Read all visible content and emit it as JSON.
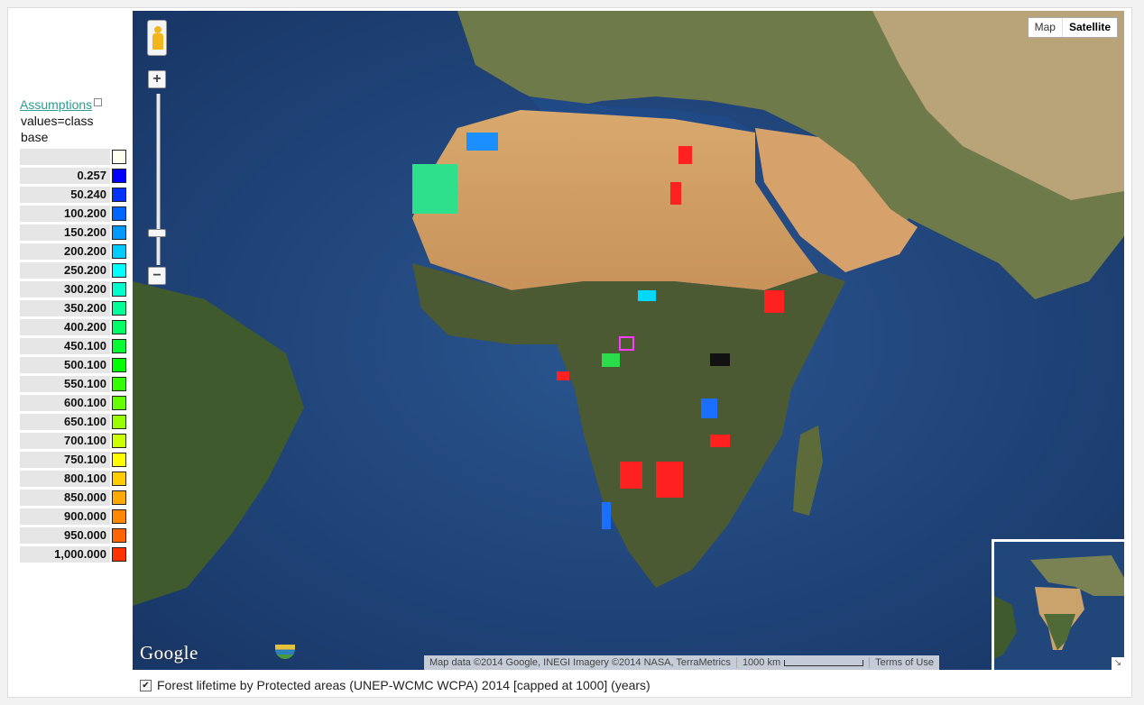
{
  "legend": {
    "link_label": "Assumptions",
    "meta_line1": "values=class",
    "meta_line2": "base",
    "items": [
      {
        "value": "",
        "color": "#fffff0"
      },
      {
        "value": "0.257",
        "color": "#0000ff"
      },
      {
        "value": "50.240",
        "color": "#0033ff"
      },
      {
        "value": "100.200",
        "color": "#0066ff"
      },
      {
        "value": "150.200",
        "color": "#0099ff"
      },
      {
        "value": "200.200",
        "color": "#00ccff"
      },
      {
        "value": "250.200",
        "color": "#00ffff"
      },
      {
        "value": "300.200",
        "color": "#00ffcc"
      },
      {
        "value": "350.200",
        "color": "#00ff99"
      },
      {
        "value": "400.200",
        "color": "#00ff66"
      },
      {
        "value": "450.100",
        "color": "#00ff33"
      },
      {
        "value": "500.100",
        "color": "#00ff00"
      },
      {
        "value": "550.100",
        "color": "#33ff00"
      },
      {
        "value": "600.100",
        "color": "#66ff00"
      },
      {
        "value": "650.100",
        "color": "#99ff00"
      },
      {
        "value": "700.100",
        "color": "#ccff00"
      },
      {
        "value": "750.100",
        "color": "#ffff00"
      },
      {
        "value": "800.100",
        "color": "#ffcc00"
      },
      {
        "value": "850.000",
        "color": "#ffaa00"
      },
      {
        "value": "900.000",
        "color": "#ff8800"
      },
      {
        "value": "950.000",
        "color": "#ff6600"
      },
      {
        "value": "1,000.000",
        "color": "#ff3300"
      }
    ]
  },
  "map": {
    "type_map_label": "Map",
    "type_satellite_label": "Satellite",
    "zoom_in_label": "+",
    "zoom_out_label": "−",
    "logo_text": "Google",
    "attribution": "Map data ©2014 Google, INEGI Imagery ©2014 NASA, TerraMetrics",
    "scale_label": "1000 km",
    "terms_label": "Terms of Use",
    "overview_toggle": "↘",
    "pegman_icon": "pegman-icon"
  },
  "caption": {
    "checkbox_checked": true,
    "text": "Forest lifetime by Protected areas (UNEP-WCMC WCPA) 2014 [capped at 1000] (years)"
  }
}
